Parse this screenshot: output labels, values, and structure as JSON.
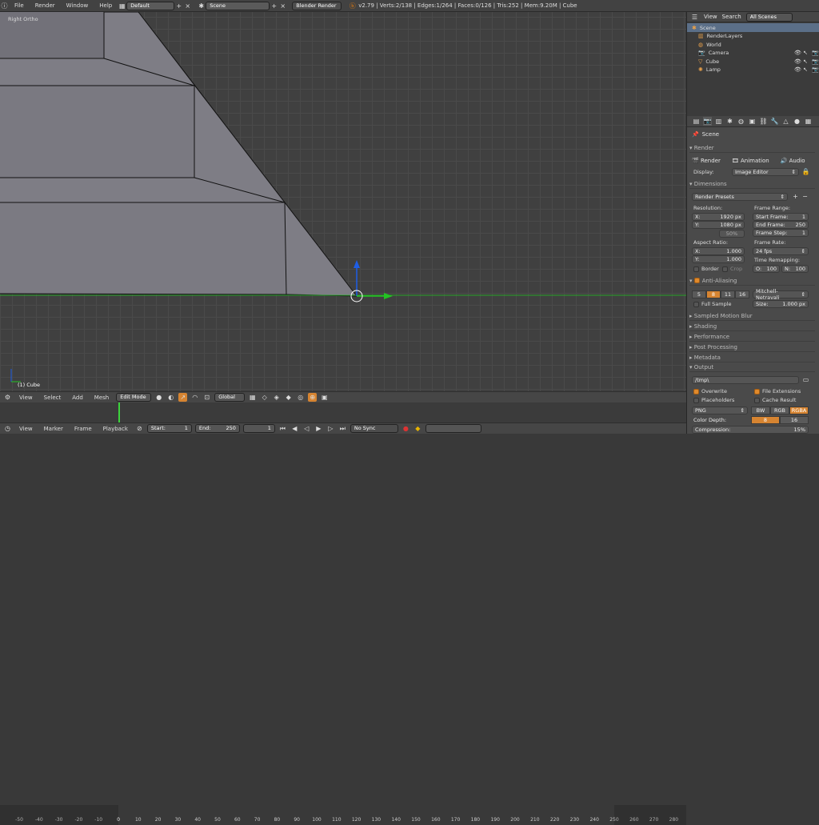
{
  "topbar": {
    "menus": [
      "File",
      "Render",
      "Window",
      "Help"
    ],
    "screen_layout": "Default",
    "scene": "Scene",
    "engine": "Blender Render",
    "stats": "v2.79 | Verts:2/138 | Edges:1/264 | Faces:0/126 | Tris:252 | Mem:9.20M | Cube"
  },
  "viewport": {
    "view_label": "Right Ortho",
    "object_label": "(1) Cube"
  },
  "viewport_header": {
    "view": "View",
    "select": "Select",
    "add": "Add",
    "mesh": "Mesh",
    "mode": "Edit Mode",
    "orientation": "Global"
  },
  "timeline": {
    "ruler": [
      "-50",
      "-40",
      "-30",
      "-20",
      "-10",
      "0",
      "10",
      "20",
      "30",
      "40",
      "50",
      "60",
      "70",
      "80",
      "90",
      "100",
      "110",
      "120",
      "130",
      "140",
      "150",
      "160",
      "170",
      "180",
      "190",
      "200",
      "210",
      "220",
      "230",
      "240",
      "250",
      "260",
      "270",
      "280"
    ],
    "current_frame_marker": 0,
    "header": {
      "view": "View",
      "marker": "Marker",
      "frame": "Frame",
      "playback": "Playback",
      "start_label": "Start:",
      "start": "1",
      "end_label": "End:",
      "end": "250",
      "current": "1",
      "sync": "No Sync"
    }
  },
  "outliner": {
    "header": {
      "view": "View",
      "search": "Search",
      "filter": "All Scenes"
    },
    "items": [
      {
        "label": "Scene",
        "icon": "scene-icon",
        "indent": 0,
        "selected": true
      },
      {
        "label": "RenderLayers",
        "icon": "renderlayers-icon",
        "indent": 1
      },
      {
        "label": "World",
        "icon": "world-icon",
        "indent": 1
      },
      {
        "label": "Camera",
        "icon": "camera-icon",
        "indent": 1
      },
      {
        "label": "Cube",
        "icon": "mesh-icon",
        "indent": 1
      },
      {
        "label": "Lamp",
        "icon": "lamp-icon",
        "indent": 1
      }
    ]
  },
  "properties": {
    "context": "Scene",
    "render": {
      "title": "Render",
      "buttons": [
        "Render",
        "Animation",
        "Audio"
      ],
      "display_label": "Display:",
      "display_value": "Image Editor"
    },
    "dimensions": {
      "title": "Dimensions",
      "presets": "Render Presets",
      "resolution_label": "Resolution:",
      "x_label": "X:",
      "x": "1920 px",
      "y_label": "Y:",
      "y": "1080 px",
      "percent": "50%",
      "frame_range_label": "Frame Range:",
      "start_frame_label": "Start Frame:",
      "start_frame": "1",
      "end_frame_label": "End Frame:",
      "end_frame": "250",
      "frame_step_label": "Frame Step:",
      "frame_step": "1",
      "aspect_label": "Aspect Ratio:",
      "ax": "1.000",
      "ay": "1.000",
      "frame_rate_label": "Frame Rate:",
      "frame_rate": "24 fps",
      "time_remap_label": "Time Remapping:",
      "old_label": "O:",
      "old": "100",
      "new_label": "N:",
      "new": "100",
      "border": "Border",
      "crop": "Crop"
    },
    "antialiasing": {
      "title": "Anti-Aliasing",
      "samples": [
        "5",
        "8",
        "11",
        "16"
      ],
      "active_sample": "8",
      "filter": "Mitchell-Netravali",
      "full_sample": "Full Sample",
      "size_label": "Size:",
      "size": "1.000 px"
    },
    "collapsed": [
      "Sampled Motion Blur",
      "Shading",
      "Performance",
      "Post Processing",
      "Metadata"
    ],
    "output": {
      "title": "Output",
      "path": "/tmp\\",
      "overwrite": "Overwrite",
      "file_extensions": "File Extensions",
      "placeholders": "Placeholders",
      "cache_result": "Cache Result",
      "format": "PNG",
      "color_modes": [
        "BW",
        "RGB",
        "RGBA"
      ],
      "active_color": "RGBA",
      "color_depth_label": "Color Depth:",
      "depths": [
        "8",
        "16"
      ],
      "active_depth": "8",
      "compression_label": "Compression:",
      "compression": "15%"
    }
  },
  "colors": {
    "accent": "#d68431",
    "x_axis": "#22c322",
    "z_axis": "#1e5ee6",
    "mesh_face": "#7e7d85"
  }
}
